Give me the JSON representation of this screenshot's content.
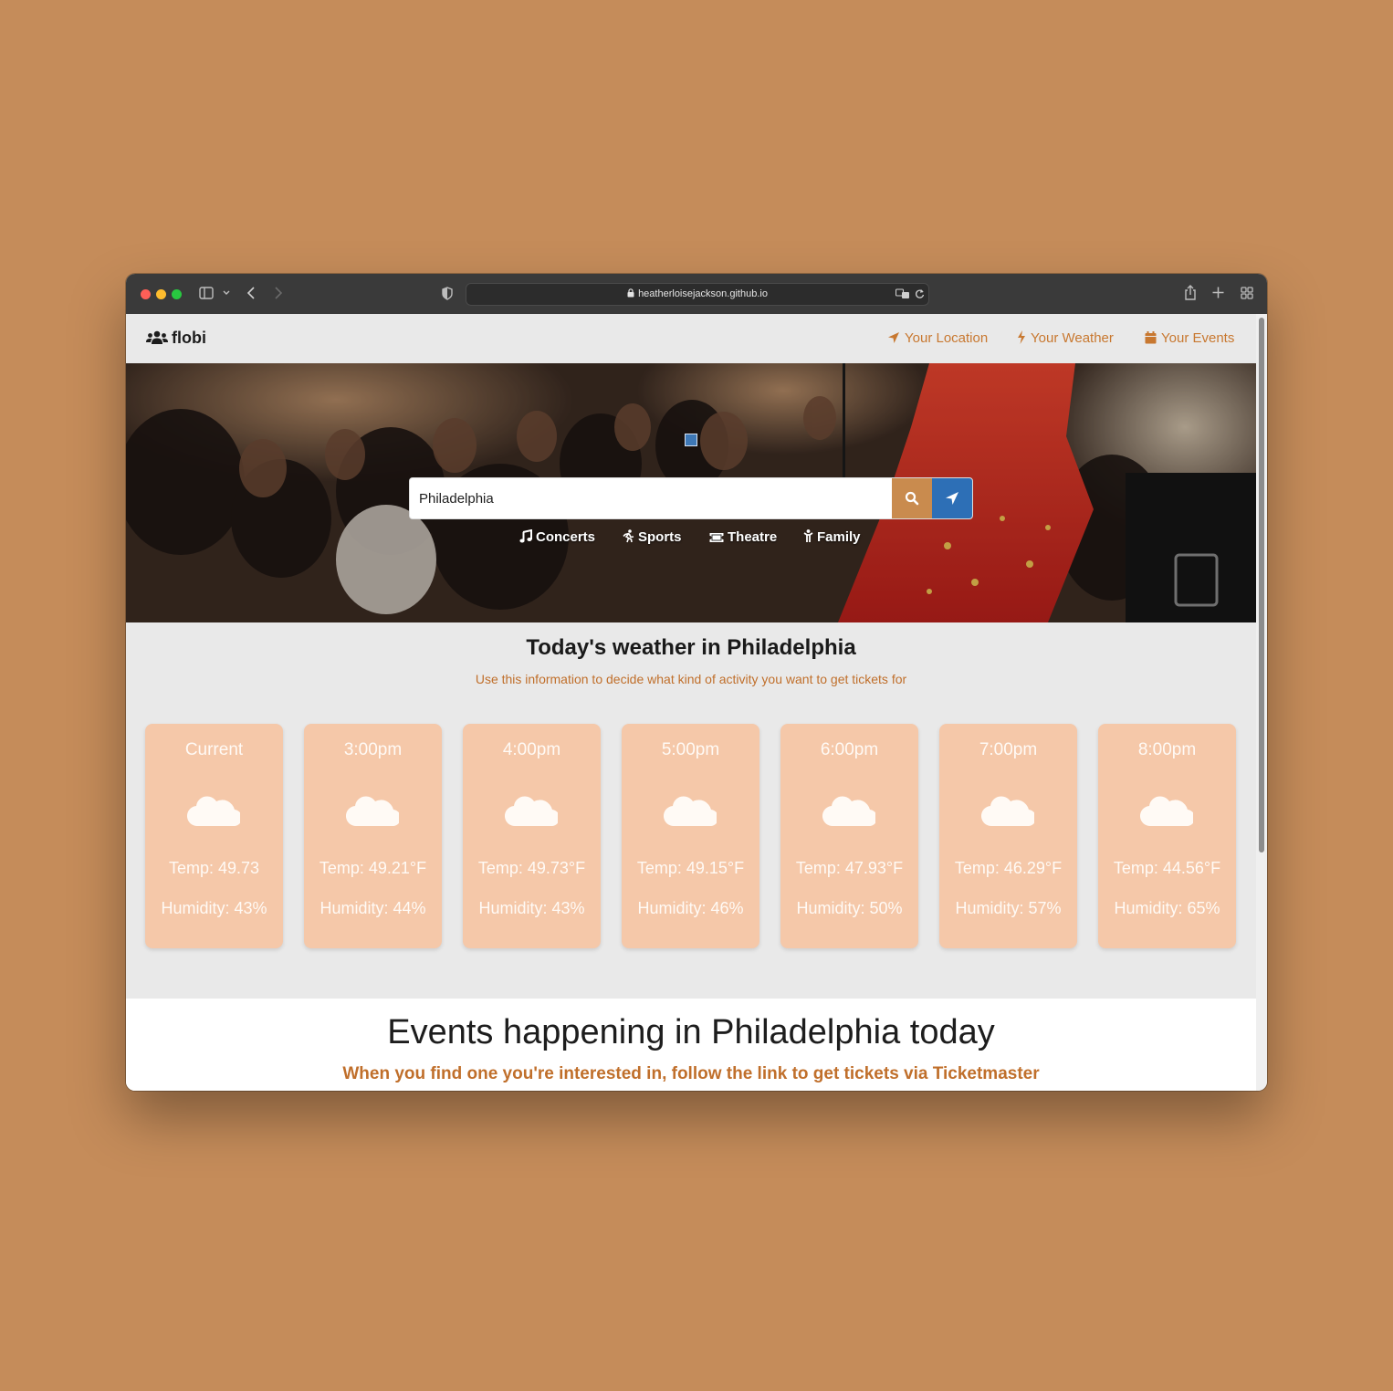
{
  "browser": {
    "url": "heatherloisejackson.github.io"
  },
  "navbar": {
    "brand": "flobi",
    "links": [
      {
        "label": "Your Location",
        "icon": "location-arrow-icon"
      },
      {
        "label": "Your Weather",
        "icon": "bolt-icon"
      },
      {
        "label": "Your Events",
        "icon": "calendar-icon"
      }
    ]
  },
  "hero": {
    "search_value": "Philadelphia",
    "categories": [
      {
        "label": "Concerts",
        "icon": "music-icon"
      },
      {
        "label": "Sports",
        "icon": "running-icon"
      },
      {
        "label": "Theatre",
        "icon": "ticket-icon"
      },
      {
        "label": "Family",
        "icon": "child-icon"
      }
    ]
  },
  "weather": {
    "title": "Today's weather in Philadelphia",
    "subtitle": "Use this information to decide what kind of activity you want to get tickets for",
    "cards": [
      {
        "time": "Current",
        "temp": "Temp: 49.73",
        "humidity": "Humidity: 43%"
      },
      {
        "time": "3:00pm",
        "temp": "Temp: 49.21°F",
        "humidity": "Humidity: 44%"
      },
      {
        "time": "4:00pm",
        "temp": "Temp: 49.73°F",
        "humidity": "Humidity: 43%"
      },
      {
        "time": "5:00pm",
        "temp": "Temp: 49.15°F",
        "humidity": "Humidity: 46%"
      },
      {
        "time": "6:00pm",
        "temp": "Temp: 47.93°F",
        "humidity": "Humidity: 50%"
      },
      {
        "time": "7:00pm",
        "temp": "Temp: 46.29°F",
        "humidity": "Humidity: 57%"
      },
      {
        "time": "8:00pm",
        "temp": "Temp: 44.56°F",
        "humidity": "Humidity: 65%"
      }
    ]
  },
  "events": {
    "title": "Events happening in Philadelphia today",
    "subtitle": "When you find one you're interested in, follow the link to get tickets via Ticketmaster"
  },
  "colors": {
    "accent": "#c87830",
    "card": "#f5c8a9",
    "search_button": "#c98b4e",
    "locate_button": "#2d6fb6",
    "background": "#c58c5a"
  }
}
